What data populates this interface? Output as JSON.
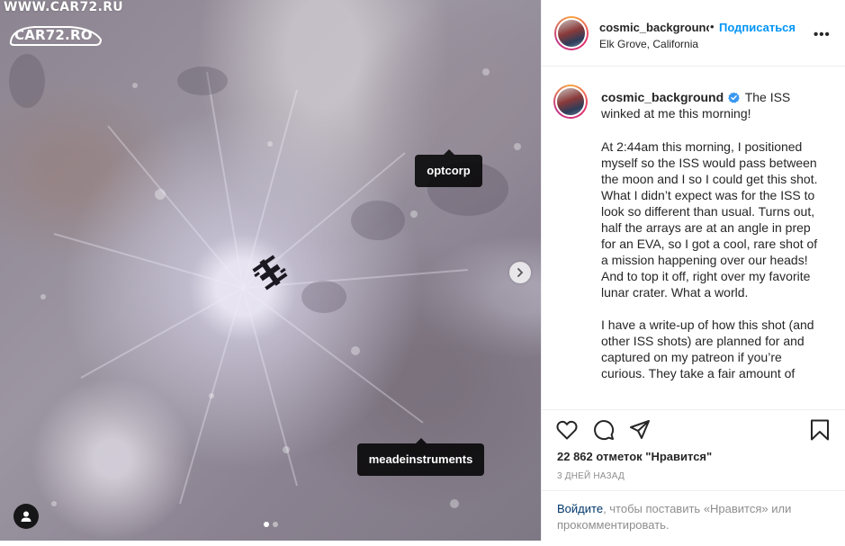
{
  "watermark": {
    "site_text": "WWW.CAR72.RU",
    "logo_text": "CAR72.RO"
  },
  "photo": {
    "tags": [
      "optcorp",
      "meadeinstruments"
    ],
    "slide_count": 2,
    "active_slide": 1
  },
  "header": {
    "username": "cosmic_backgrounc",
    "separator": "•",
    "follow_label": "Подписаться",
    "location": "Elk Grove, California",
    "more_label": "•••"
  },
  "caption": {
    "username": "cosmic_background",
    "headline": "The ISS winked at me this morning!",
    "paragraph1": "At 2:44am this morning, I positioned myself so the ISS would pass between the moon and I so I could get this shot. What I didn’t expect was for the ISS to look so different than usual. Turns out, half the arrays are at an angle in prep for an EVA, so I got a cool, rare shot of a mission happening over our heads! And to top it off, right over my favorite lunar crater. What a world.",
    "paragraph2": "I have a write-up of how this shot (and other ISS shots) are planned for and captured on my patreon if you’re curious. They take a fair amount of"
  },
  "actions": {
    "likes_text": "22 862 отметок \"Нравится\"",
    "time_text": "3 ДНЕЙ НАЗАД"
  },
  "login": {
    "link_text": "Войдите",
    "rest_text": ", чтобы поставить «Нравится» или прокомментировать."
  },
  "colors": {
    "link_blue": "#0095f6",
    "verified_blue": "#3897f0",
    "muted_text": "#8e8e8e",
    "dark_link": "#00376b"
  }
}
